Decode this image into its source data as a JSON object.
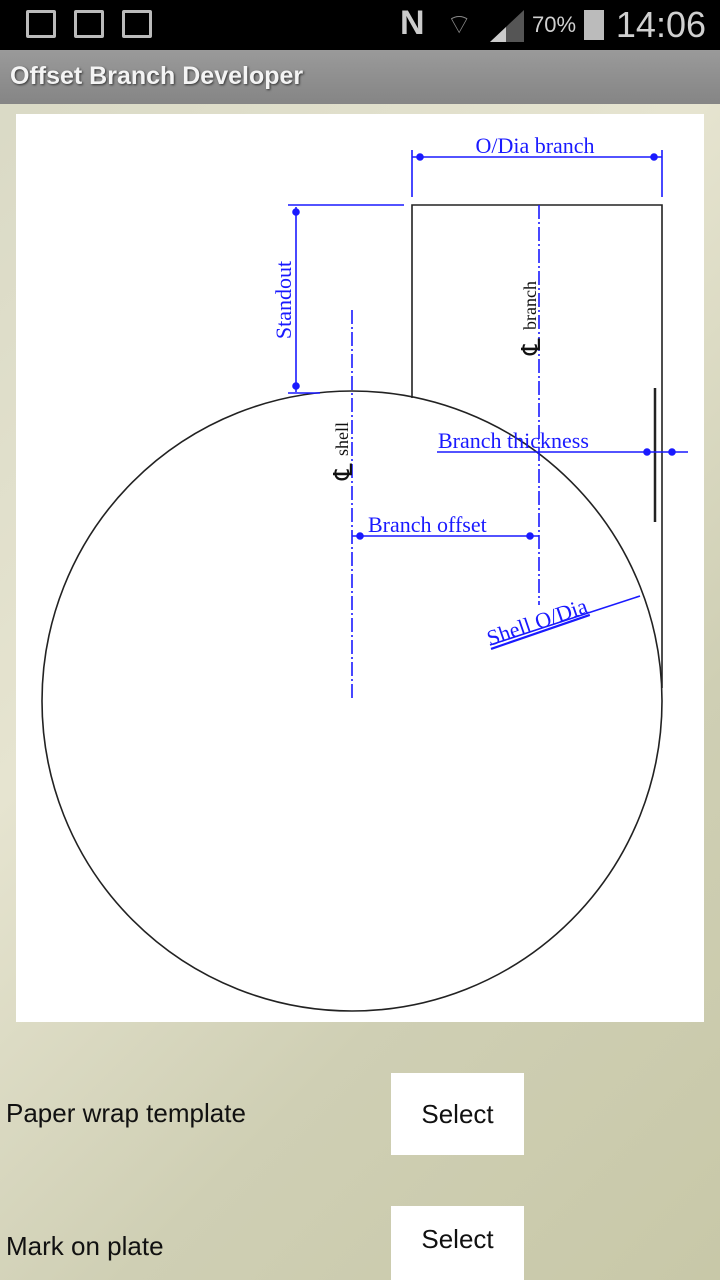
{
  "status_bar": {
    "battery": "70%",
    "time": "14:06",
    "icons": [
      "gallery-icon",
      "store-check-icon",
      "store-play-icon",
      "nfc-icon",
      "wifi-icon",
      "signal-icon",
      "battery-icon"
    ]
  },
  "app_bar": {
    "title": "Offset Branch Developer"
  },
  "diagram": {
    "labels": {
      "odia_branch": "O/Dia branch",
      "standout": "Standout",
      "branch_thickness": "Branch thickness",
      "branch_offset": "Branch offset",
      "shell_odia": "Shell O/Dia",
      "cl_shell": "shell",
      "cl_branch": "branch",
      "cl_symbol": "℄"
    },
    "colors": {
      "dimension": "#1a1aff",
      "outline": "#222222"
    }
  },
  "options": [
    {
      "label": "Paper wrap template",
      "button": "Select"
    },
    {
      "label": "Mark on plate",
      "button": "Select"
    }
  ]
}
